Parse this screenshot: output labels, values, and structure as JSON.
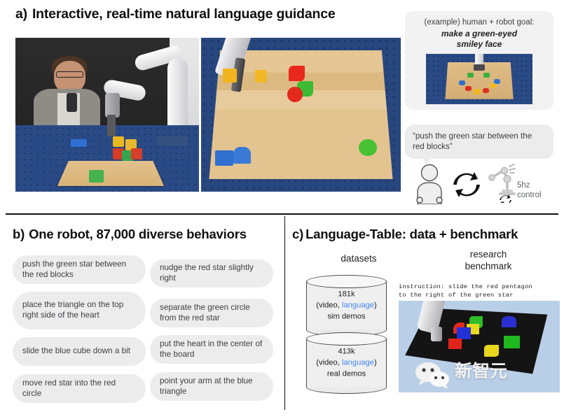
{
  "section_a": {
    "index": "a)",
    "title": "Interactive, real-time natural language guidance",
    "photo_human_name": "human-robot-tabletop-photo",
    "photo_board_name": "robot-board-topdown-photo",
    "goal_card": {
      "prefix": "(example) human + robot goal:",
      "goal": "make a green-eyed\nsmiley face",
      "goal_line1": "make a green-eyed",
      "goal_line2": "smiley face"
    },
    "speech": "“push the green star between the red blocks”",
    "loop": {
      "human_icon": "human-icon",
      "cycle_icon": "cycle-arrows-icon",
      "robot_icon": "robot-arm-icon",
      "rate_line1": "5hz",
      "rate_line2": "control"
    }
  },
  "section_b": {
    "index": "b)",
    "title": "One robot, 87,000 diverse behaviors",
    "behaviors_left": [
      "push the green star between the red blocks",
      "place the triangle on the top right side of the heart",
      "slide the blue cube down a bit",
      "move red star into the red circle"
    ],
    "behaviors_right": [
      "nudge the red star slightly right",
      "separate the green circle from the red star",
      "put the heart in the center of the board",
      "point your arm at the blue triangle"
    ]
  },
  "section_c": {
    "index": "c)",
    "title": "Language-Table: data + benchmark",
    "datasets_label": "datasets",
    "benchmark_label_line1": "research",
    "benchmark_label_line2": "benchmark",
    "datasets": [
      {
        "count": "181k",
        "modalities_prefix": "(video, ",
        "modalities_highlight": "language",
        "modalities_suffix": ")",
        "kind": "sim demos"
      },
      {
        "count": "413k",
        "modalities_prefix": "(video, ",
        "modalities_highlight": "language",
        "modalities_suffix": ")",
        "kind": "real demos"
      }
    ],
    "benchmark_instruction_line1": "instruction: slide the red pentagon",
    "benchmark_instruction_line2": "to the right of the green star",
    "benchmark_image_name": "simulated-robot-benchmark-scene"
  },
  "watermark": {
    "text": "新智元",
    "logo": "wechat-icon"
  },
  "colors": {
    "bubble_bg": "#ececec",
    "card_bg": "#f2f2f2",
    "language_blue": "#4285f4",
    "text": "#202124",
    "muted_text": "#5f6368",
    "divider": "#111111"
  }
}
